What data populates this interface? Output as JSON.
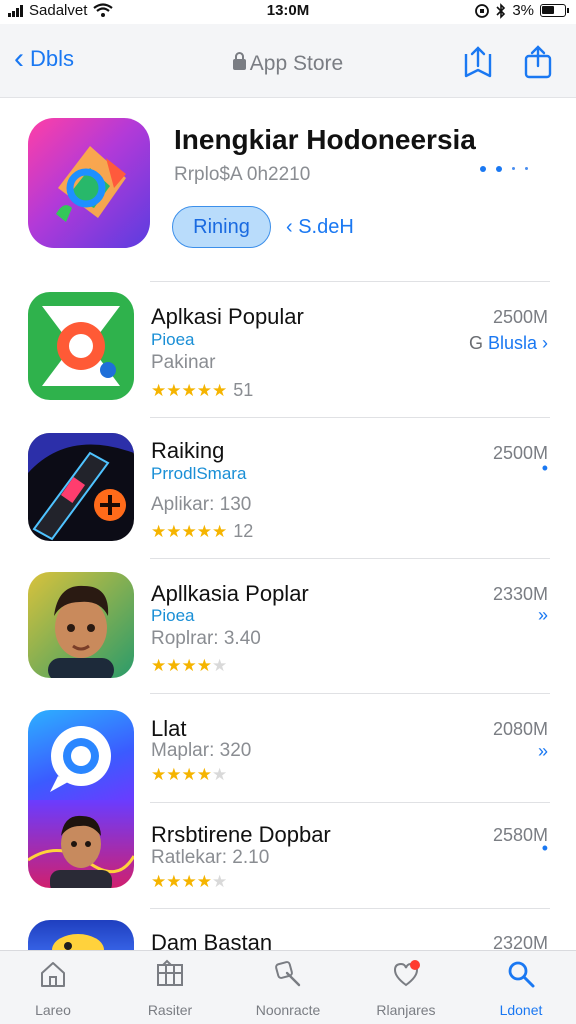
{
  "status": {
    "carrier": "Sadalvet",
    "time": "13:0M",
    "battery": "3%"
  },
  "nav": {
    "back_label": "Dbls",
    "title": "App Store"
  },
  "hero": {
    "title": "Inengkiar Hodoneersia",
    "subtitle": "Rrplo$A 0h2210",
    "get_label": "Rining",
    "share_label": "S.deH"
  },
  "apps": [
    {
      "name": "Aplkasi Popular",
      "category": "Pioea",
      "meta": "Pakinar",
      "rating": "★★★★★",
      "rating_dim": "",
      "count": "51",
      "size": "2500M",
      "action": "Blusla ›",
      "action_prefix": "G"
    },
    {
      "name": "Raiking",
      "category": "PrrodlSmara",
      "meta": "Aplikar: 130",
      "rating": "★★★★★",
      "rating_dim": "",
      "count": "12",
      "size": "2500M",
      "action": "•",
      "action_prefix": ""
    },
    {
      "name": "Apllkasia Poplar",
      "category": "Pioea",
      "meta": "Roplrar: 3.40",
      "rating": "★★★★",
      "rating_dim": "★",
      "count": "",
      "size": "2330M",
      "action": "»",
      "action_prefix": ""
    },
    {
      "name": "Llat",
      "category": "",
      "meta": "Maplar: 320",
      "rating": "★★★★",
      "rating_dim": "★",
      "count": "",
      "size": "2080M",
      "action": "»",
      "action_prefix": ""
    },
    {
      "name": "Rrsbtirene Dopbar",
      "category": "",
      "meta": "Ratlekar: 2.10",
      "rating": "★★★★",
      "rating_dim": "★",
      "count": "",
      "size": "2580M",
      "action": "•",
      "action_prefix": ""
    },
    {
      "name": "Dam Bastan",
      "category": "",
      "meta": "",
      "rating": "",
      "rating_dim": "",
      "count": "",
      "size": "2320M",
      "action": "",
      "action_prefix": ""
    }
  ],
  "tabs": [
    {
      "label": "Lareo",
      "icon": "home-icon",
      "active": false
    },
    {
      "label": "Rasiter",
      "icon": "grid-icon",
      "active": false
    },
    {
      "label": "Noonracte",
      "icon": "search-glyph-icon",
      "active": false
    },
    {
      "label": "Rlanjares",
      "icon": "heart-badge-icon",
      "active": false
    },
    {
      "label": "Ldonet",
      "icon": "search-icon",
      "active": true
    }
  ],
  "colors": {
    "accent": "#1a78f2",
    "get_fill": "#b9dcfb",
    "star": "#f5b400"
  }
}
